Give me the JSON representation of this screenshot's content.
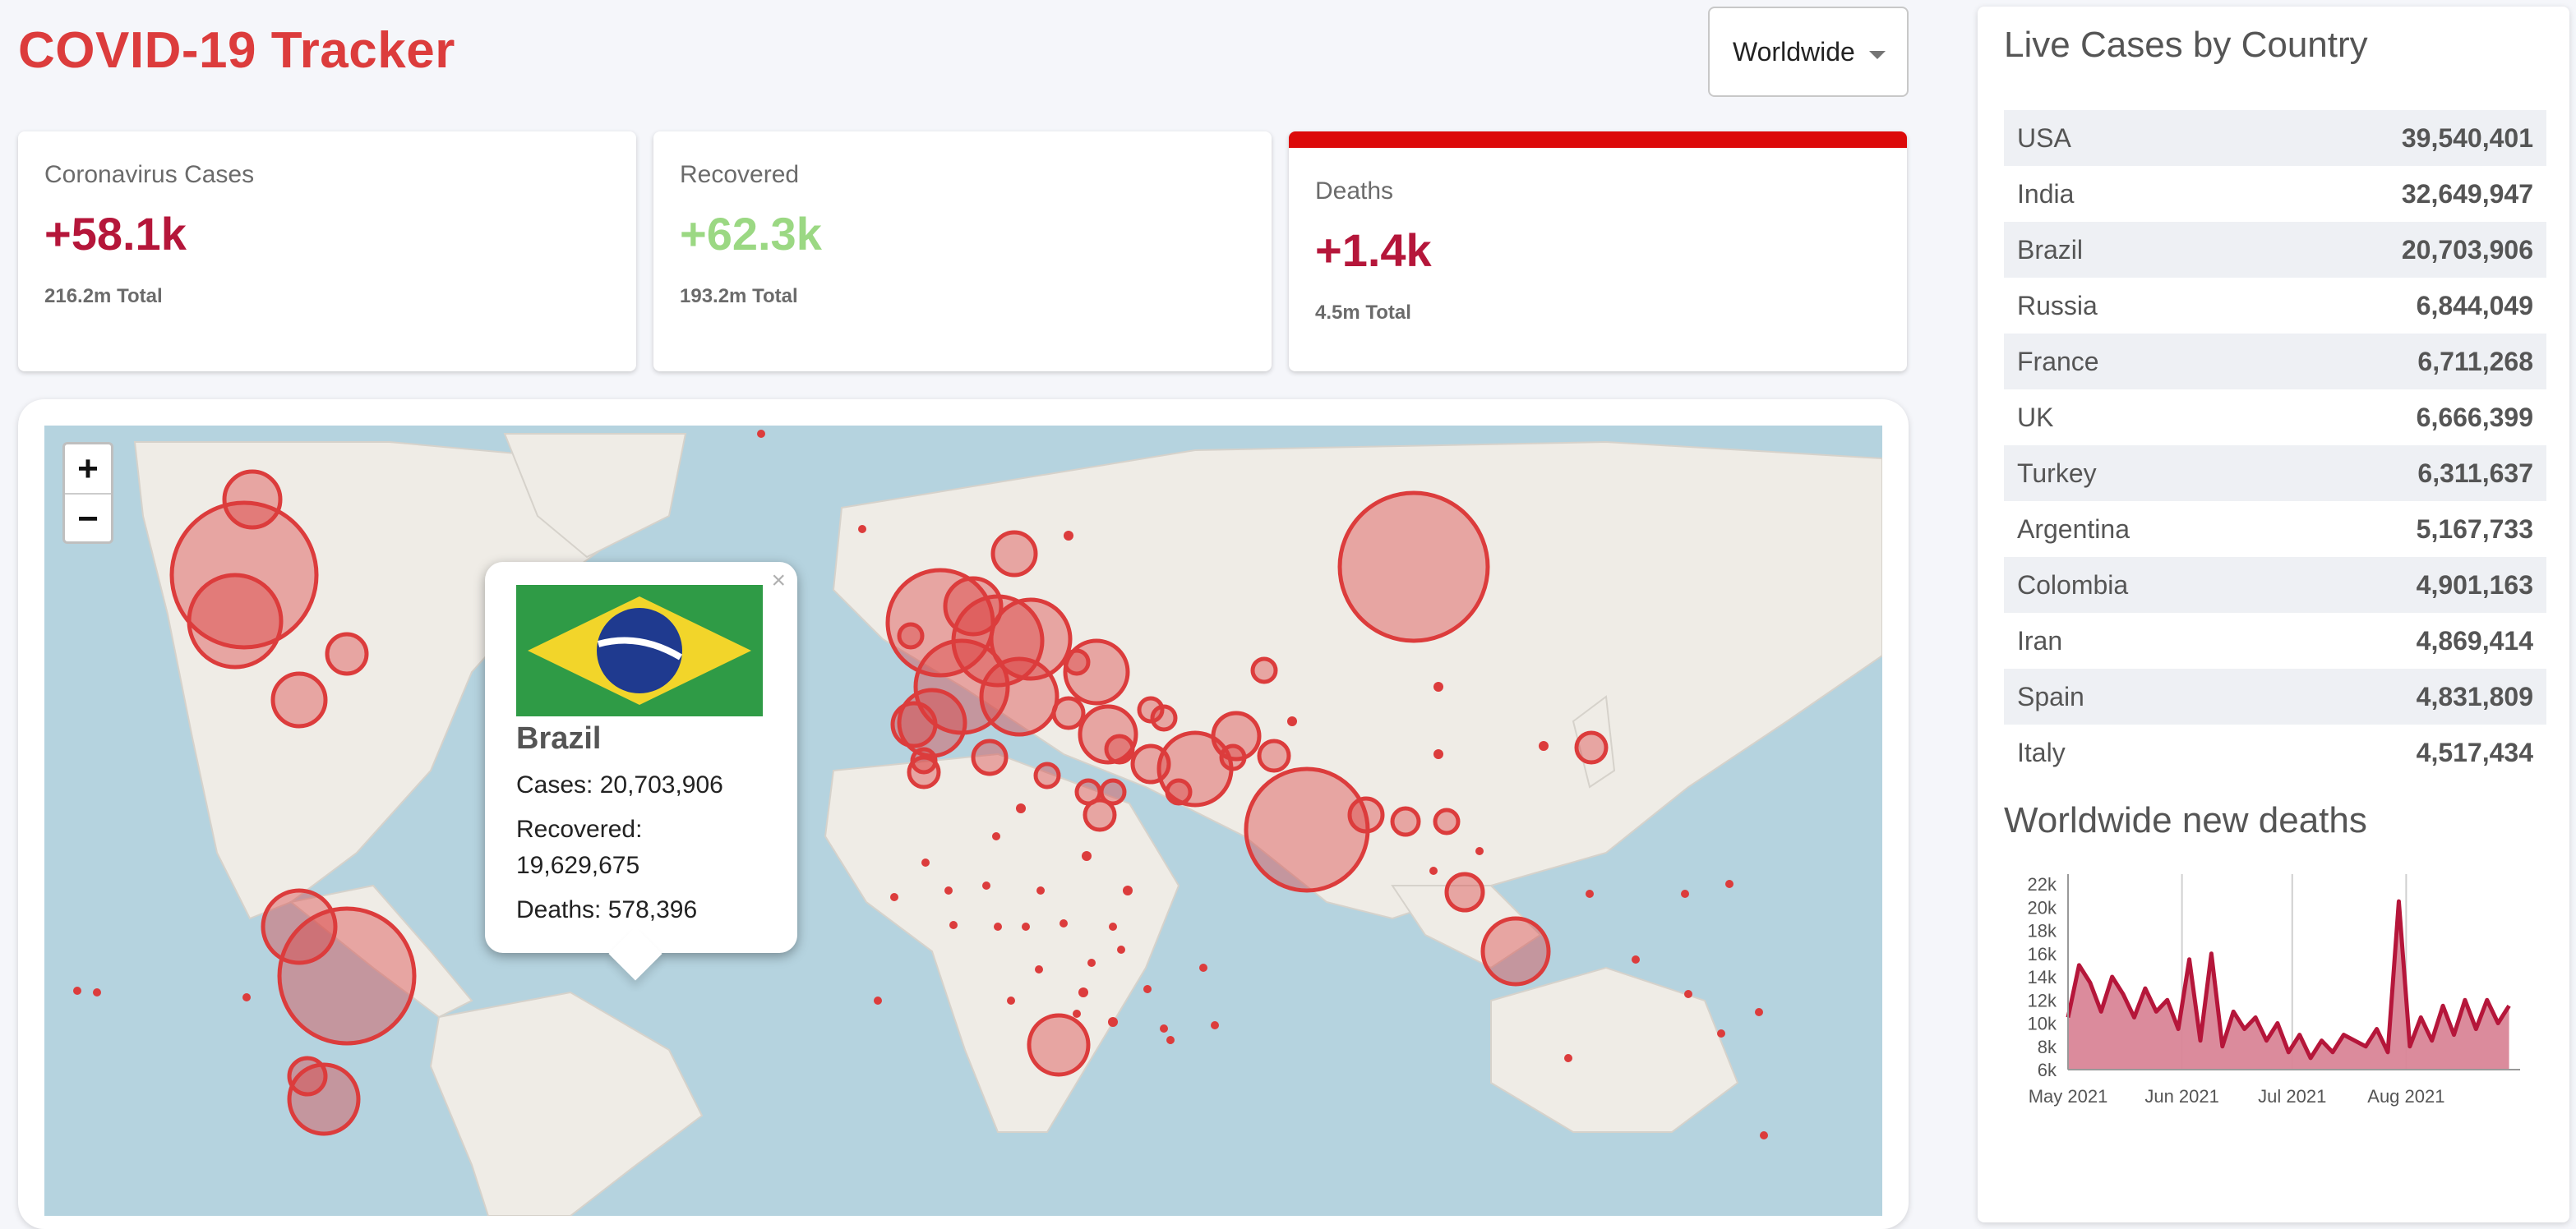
{
  "header": {
    "title": "COVID-19 Tracker",
    "country_select": "Worldwide"
  },
  "stats": [
    {
      "title": "Coronavirus Cases",
      "value": "+58.1k",
      "total": "216.2m Total",
      "color": "#b5163a"
    },
    {
      "title": "Recovered",
      "value": "+62.3k",
      "total": "193.2m Total",
      "color": "#9bd883"
    },
    {
      "title": "Deaths",
      "value": "+1.4k",
      "total": "4.5m Total",
      "color": "#b5163a",
      "selected": true
    }
  ],
  "map": {
    "zoom_in": "+",
    "zoom_out": "−",
    "popup": {
      "close": "×",
      "country": "Brazil",
      "cases": "Cases: 20,703,906",
      "recovered_label": "Recovered:",
      "recovered_value": "19,629,675",
      "deaths": "Deaths: 578,396"
    }
  },
  "sidebar": {
    "table_title": "Live Cases by Country",
    "countries": [
      {
        "name": "USA",
        "cases": "39,540,401"
      },
      {
        "name": "India",
        "cases": "32,649,947"
      },
      {
        "name": "Brazil",
        "cases": "20,703,906"
      },
      {
        "name": "Russia",
        "cases": "6,844,049"
      },
      {
        "name": "France",
        "cases": "6,711,268"
      },
      {
        "name": "UK",
        "cases": "6,666,399"
      },
      {
        "name": "Turkey",
        "cases": "6,311,637"
      },
      {
        "name": "Argentina",
        "cases": "5,167,733"
      },
      {
        "name": "Colombia",
        "cases": "4,901,163"
      },
      {
        "name": "Iran",
        "cases": "4,869,414"
      },
      {
        "name": "Spain",
        "cases": "4,831,809"
      },
      {
        "name": "Italy",
        "cases": "4,517,434"
      }
    ],
    "chart_title": "Worldwide new deaths"
  },
  "chart_data": {
    "type": "area",
    "title": "Worldwide new deaths",
    "xlabel": "",
    "ylabel": "",
    "x_ticks": [
      "May 2021",
      "Jun 2021",
      "Jul 2021",
      "Aug 2021"
    ],
    "y_ticks": [
      "22k",
      "20k",
      "18k",
      "16k",
      "14k",
      "12k",
      "10k",
      "8k",
      "6k"
    ],
    "ylim": [
      6000,
      22000
    ],
    "x": [
      "2021-05-01",
      "2021-05-04",
      "2021-05-07",
      "2021-05-10",
      "2021-05-13",
      "2021-05-16",
      "2021-05-19",
      "2021-05-22",
      "2021-05-25",
      "2021-05-28",
      "2021-05-31",
      "2021-06-03",
      "2021-06-06",
      "2021-06-09",
      "2021-06-12",
      "2021-06-15",
      "2021-06-18",
      "2021-06-21",
      "2021-06-24",
      "2021-06-27",
      "2021-06-30",
      "2021-07-03",
      "2021-07-06",
      "2021-07-09",
      "2021-07-12",
      "2021-07-15",
      "2021-07-18",
      "2021-07-21",
      "2021-07-24",
      "2021-07-27",
      "2021-07-30",
      "2021-08-02",
      "2021-08-05",
      "2021-08-08",
      "2021-08-11",
      "2021-08-14",
      "2021-08-17",
      "2021-08-20",
      "2021-08-23",
      "2021-08-26",
      "2021-08-29"
    ],
    "values": [
      10500,
      15000,
      13500,
      11000,
      14000,
      12500,
      10500,
      13000,
      11000,
      12000,
      9500,
      15500,
      8500,
      16000,
      8000,
      11000,
      9500,
      10500,
      8500,
      10000,
      7500,
      9000,
      7000,
      8500,
      7500,
      9000,
      8500,
      8000,
      9500,
      7500,
      20500,
      8000,
      10500,
      8500,
      11500,
      9000,
      12000,
      9500,
      12000,
      10000,
      11500
    ],
    "color": "#b5163a",
    "fill": "#d98597"
  }
}
